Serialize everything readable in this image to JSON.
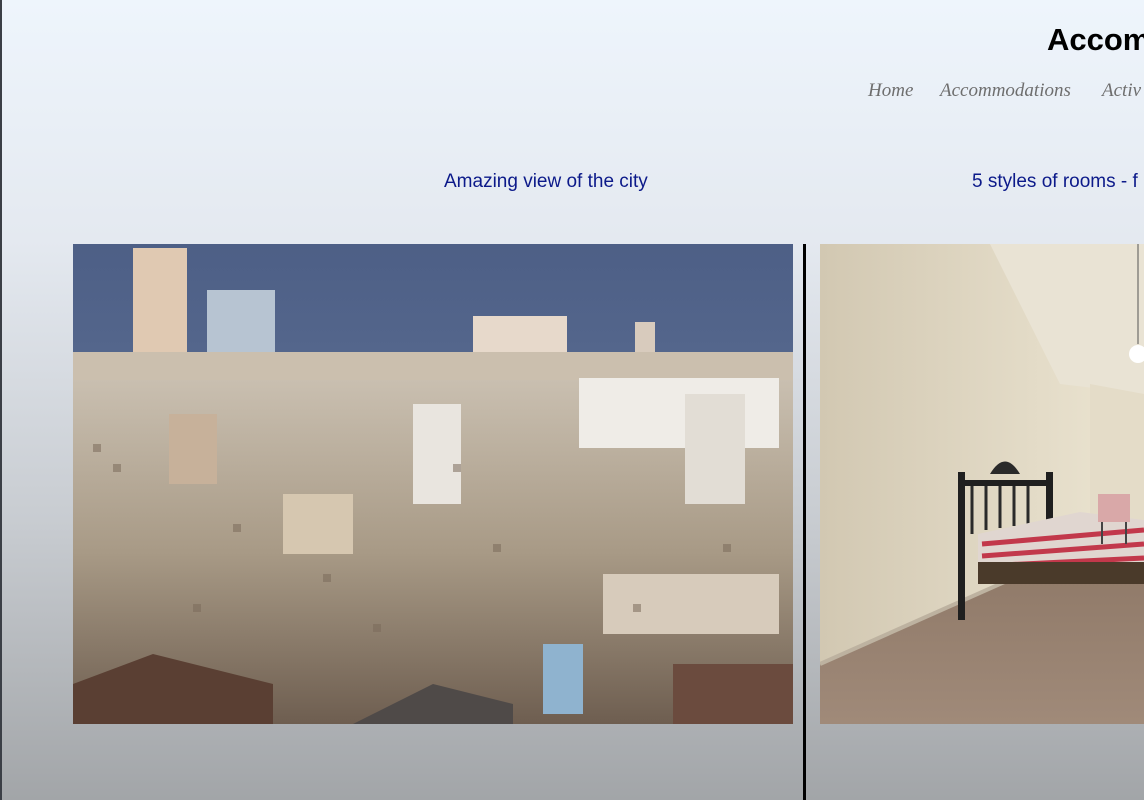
{
  "header": {
    "title": "Accom"
  },
  "nav": {
    "items": [
      {
        "label": "Home"
      },
      {
        "label": "Accommodations"
      },
      {
        "label": "Activ"
      }
    ]
  },
  "slides": [
    {
      "caption": "Amazing view of the city",
      "image": "havana-city-skyline-photo"
    },
    {
      "caption": "5 styles of rooms - f",
      "image": "room-with-iron-bed-photo"
    }
  ]
}
